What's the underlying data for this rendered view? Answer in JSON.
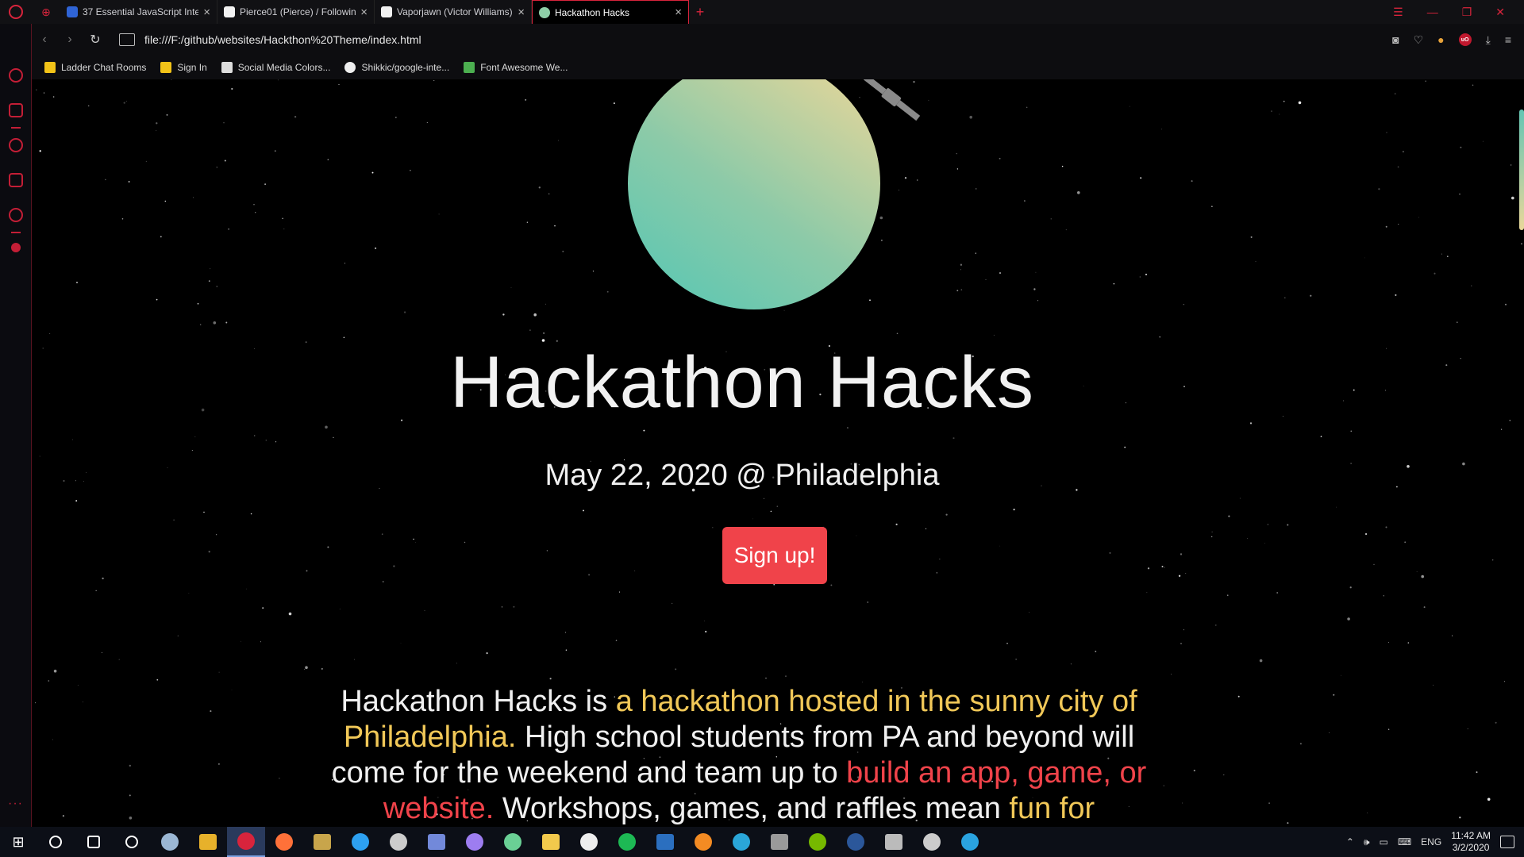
{
  "browser": {
    "tabs": [
      {
        "title": "37 Essential JavaScript Inte",
        "favicon_color": "#2f64d6"
      },
      {
        "title": "Pierce01 (Pierce) / Followin",
        "favicon_color": "#f2f2f2"
      },
      {
        "title": "Vaporjawn (Victor Williams)",
        "favicon_color": "#f2f2f2"
      },
      {
        "title": "Hackathon Hacks",
        "favicon_color": "#8fcfa8"
      }
    ],
    "url": "file:///F:/github/websites/Hackthon%20Theme/index.html",
    "bookmarks": [
      {
        "label": "Ladder Chat Rooms",
        "icon_color": "#f2c318"
      },
      {
        "label": "Sign In",
        "icon_color": "#f2c318"
      },
      {
        "label": "Social Media Colors...",
        "icon_color": "#dddddd"
      },
      {
        "label": "Shikkic/google-inte...",
        "icon_color": "#eeeeee"
      },
      {
        "label": "Font Awesome We...",
        "icon_color": "#4caf50"
      }
    ],
    "accent": "#d8243c"
  },
  "page": {
    "title": "Hackathon Hacks",
    "date_location": "May 22, 2020 @ Philadelphia",
    "signup_label": "Sign up!",
    "description": {
      "p1": "Hackathon Hacks is ",
      "h1": "a hackathon hosted in the sunny city of Philadelphia.",
      "p2": " High school students from PA and beyond will come for the weekend and team up to ",
      "h2": "build an app, game, or website.",
      "p3": " Workshops, games, and raffles mean ",
      "h3": "fun for everyone"
    },
    "colors": {
      "highlight_yellow": "#f1c858",
      "highlight_red": "#f0434a",
      "button": "#f0434a"
    }
  },
  "taskbar": {
    "apps": [
      {
        "name": "search-icon",
        "color": "#ffffff"
      },
      {
        "name": "cortana-icon",
        "color": "#ffffff"
      },
      {
        "name": "task-view-icon",
        "color": "#ffffff"
      },
      {
        "name": "steam-icon",
        "color": "#9bb7d4"
      },
      {
        "name": "chrome-icon",
        "color": "#e7b12b"
      },
      {
        "name": "opera-icon",
        "color": "#d8243c"
      },
      {
        "name": "firefox-icon",
        "color": "#ff7139"
      },
      {
        "name": "league-icon",
        "color": "#c8a54b"
      },
      {
        "name": "photoshop-icon",
        "color": "#2da0f0"
      },
      {
        "name": "obs-icon",
        "color": "#cccccc"
      },
      {
        "name": "discord-icon",
        "color": "#7289da"
      },
      {
        "name": "twitch-app-icon",
        "color": "#9d7df0"
      },
      {
        "name": "xbox-icon",
        "color": "#6ad095"
      },
      {
        "name": "file-explorer-icon",
        "color": "#f2c94c"
      },
      {
        "name": "itunes-icon",
        "color": "#eeeeee"
      },
      {
        "name": "spotify-icon",
        "color": "#1db954"
      },
      {
        "name": "musescore-icon",
        "color": "#2b6fbf"
      },
      {
        "name": "fl-studio-icon",
        "color": "#f38b23"
      },
      {
        "name": "dolphin-icon",
        "color": "#2aa6d8"
      },
      {
        "name": "wolf-icon",
        "color": "#9a9a9a"
      },
      {
        "name": "nvidia-icon",
        "color": "#76b900"
      },
      {
        "name": "word-icon",
        "color": "#2b579a"
      },
      {
        "name": "tool-icon",
        "color": "#bbbbbb"
      },
      {
        "name": "screen-icon",
        "color": "#cccccc"
      },
      {
        "name": "telegram-icon",
        "color": "#2aa3e0"
      }
    ],
    "language": "ENG",
    "time": "11:42 AM",
    "date": "3/2/2020"
  }
}
